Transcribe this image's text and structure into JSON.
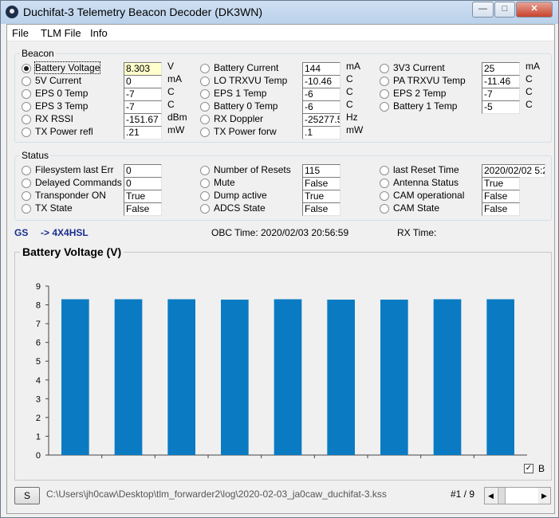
{
  "window": {
    "title": "Duchifat-3 Telemetry Beacon Decoder (DK3WN)",
    "minimize": "—",
    "maximize": "□",
    "close": "✕"
  },
  "menu": [
    "File",
    "TLM File",
    "Info"
  ],
  "beacon": {
    "title": "Beacon",
    "col1": [
      {
        "label": "Battery Voltage",
        "value": "8.303",
        "unit": "V",
        "checked": true
      },
      {
        "label": "5V Current",
        "value": "0",
        "unit": "mA"
      },
      {
        "label": "EPS 0 Temp",
        "value": "-7",
        "unit": "C"
      },
      {
        "label": "EPS 3 Temp",
        "value": "-7",
        "unit": "C"
      },
      {
        "label": "RX RSSI",
        "value": "-151.67",
        "unit": "dBm"
      },
      {
        "label": "TX Power refl",
        "value": ".21",
        "unit": "mW"
      }
    ],
    "col2": [
      {
        "label": "Battery Current",
        "value": "144",
        "unit": "mA"
      },
      {
        "label": "LO TRXVU Temp",
        "value": "-10.46",
        "unit": "C"
      },
      {
        "label": "EPS 1 Temp",
        "value": "-6",
        "unit": "C"
      },
      {
        "label": "Battery 0 Temp",
        "value": "-6",
        "unit": "C"
      },
      {
        "label": "RX Doppler",
        "value": "-25277.5",
        "unit": "Hz"
      },
      {
        "label": "TX Power forw",
        "value": ".1",
        "unit": "mW"
      }
    ],
    "col3": [
      {
        "label": "3V3 Current",
        "value": "25",
        "unit": "mA"
      },
      {
        "label": "PA TRXVU Temp",
        "value": "-11.46",
        "unit": "C"
      },
      {
        "label": "EPS 2 Temp",
        "value": "-7",
        "unit": "C"
      },
      {
        "label": "Battery 1 Temp",
        "value": "-5",
        "unit": "C"
      }
    ]
  },
  "status": {
    "title": "Status",
    "col1": [
      {
        "label": "Filesystem last Err",
        "value": "0"
      },
      {
        "label": "Delayed Commands",
        "value": "0"
      },
      {
        "label": "Transponder ON",
        "value": "True"
      },
      {
        "label": "TX State",
        "value": "False"
      }
    ],
    "col2": [
      {
        "label": "Number of Resets",
        "value": "115"
      },
      {
        "label": "Mute",
        "value": "False"
      },
      {
        "label": "Dump active",
        "value": "True"
      },
      {
        "label": "ADCS State",
        "value": "False"
      }
    ],
    "col3": [
      {
        "label": "last Reset Time",
        "value": "2020/02/02 5:2"
      },
      {
        "label": "Antenna Status",
        "value": "True"
      },
      {
        "label": "CAM operational",
        "value": "False"
      },
      {
        "label": "CAM State",
        "value": "False"
      }
    ]
  },
  "info_line": {
    "gs_label": "GS",
    "gs_value": "-> 4X4HSL",
    "obc_time": "OBC Time: 2020/02/03 20:56:59",
    "rx_time": "RX Time:"
  },
  "chart_data": {
    "type": "bar",
    "title": "Battery Voltage (V)",
    "values": [
      8.3,
      8.3,
      8.3,
      8.28,
      8.3,
      8.28,
      8.28,
      8.3,
      8.3
    ],
    "ylim": [
      0,
      9
    ],
    "yticks": [
      "0",
      "1",
      "2",
      "3",
      "4",
      "5",
      "6",
      "7",
      "8",
      "9"
    ],
    "bar_color": "#0a7bc2",
    "legend_label": "B",
    "legend_checked": true
  },
  "footer": {
    "button": "S",
    "path": "C:\\Users\\jh0caw\\Desktop\\tlm_forwarder2\\log\\2020-02-03_ja0caw_duchifat-3.kss",
    "page": "#1 / 9"
  }
}
